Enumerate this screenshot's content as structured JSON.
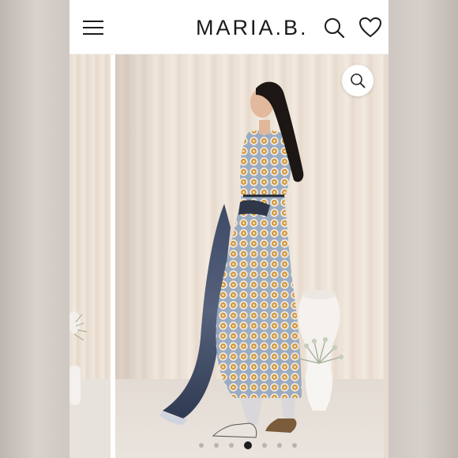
{
  "header": {
    "brand": "MARIA.B.",
    "icons": {
      "menu": "hamburger-menu-icon",
      "search": "search-icon",
      "wishlist": "heart-icon"
    }
  },
  "gallery": {
    "zoom_icon": "magnifier-zoom-icon",
    "slide_count": 7,
    "active_slide": 4
  },
  "colors": {
    "text": "#1a1a1a",
    "dot_inactive": "#b8b3ae",
    "dot_active": "#1e1e1e",
    "dress_blue": "#9aaabd",
    "dress_orange": "#d69a3c"
  }
}
